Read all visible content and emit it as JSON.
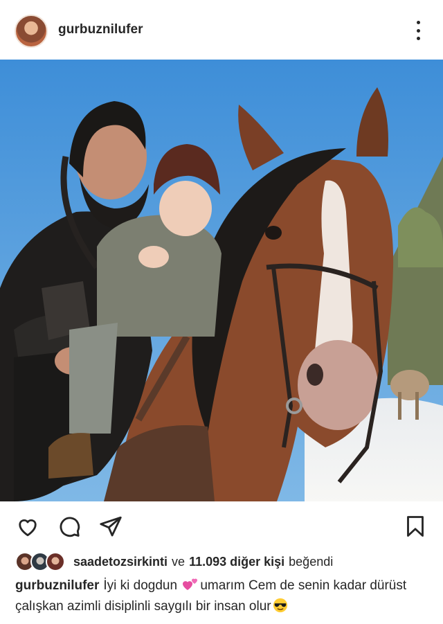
{
  "post": {
    "username": "gurbuznilufer",
    "photo_alt": "Post photo"
  },
  "icons": {
    "more": "more-vertical-icon",
    "like": "heart-outline-icon",
    "comment": "comment-bubble-icon",
    "share": "paper-plane-icon",
    "save": "bookmark-outline-icon"
  },
  "likes": {
    "first_liker": "saadetozsirkinti",
    "joiner": "ve",
    "others_count": "11.093 diğer kişi",
    "suffix": "beğendi"
  },
  "caption": {
    "username": "gurbuznilufer",
    "part1": "İyi ki dogdun",
    "part2": "umarım Cem de senin kadar dürüst çalışkan azimli disiplinli saygılı bir insan olur"
  },
  "colors": {
    "text": "#262626",
    "sky": "#3d8fd6",
    "horse": "#8a4a2c"
  }
}
